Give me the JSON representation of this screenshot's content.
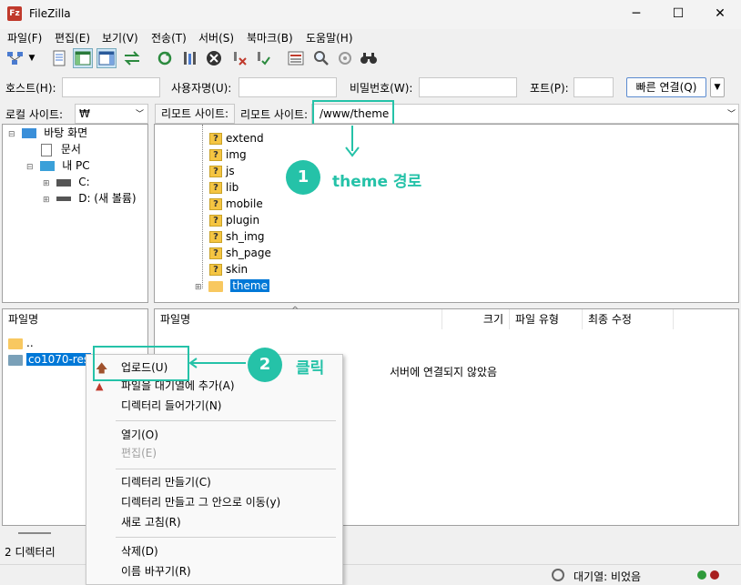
{
  "window": {
    "title": "FileZilla",
    "app_icon_glyph": "Fz",
    "minimize": "─",
    "maximize": "☐",
    "close": "✕"
  },
  "menu": [
    "파일(F)",
    "편집(E)",
    "보기(V)",
    "전송(T)",
    "서버(S)",
    "북마크(B)",
    "도움말(H)"
  ],
  "quickconnect": {
    "host_label": "호스트(H):",
    "host_value": "",
    "user_label": "사용자명(U):",
    "user_value": "",
    "pass_label": "비밀번호(W):",
    "pass_value": "",
    "port_label": "포트(P):",
    "port_value": "",
    "connect_button": "빠른 연결(Q)"
  },
  "local": {
    "site_label": "로컬 사이트:",
    "site_path": "₩",
    "tree": [
      "바탕 화면",
      "문서",
      "내 PC",
      "C:",
      "D: (새 볼륨)"
    ],
    "list_header": "파일명",
    "files": [
      "..",
      "co1070-res"
    ],
    "status": "2 디렉터리"
  },
  "remote": {
    "site_button": "리모트 사이트:",
    "site_label": "리모트 사이트:",
    "site_path": "/www/theme",
    "tree": [
      "extend",
      "img",
      "js",
      "lib",
      "mobile",
      "plugin",
      "sh_img",
      "sh_page",
      "skin",
      "theme"
    ],
    "columns": [
      "파일명",
      "크기",
      "파일 유형",
      "최종 수정"
    ],
    "empty_message": "서버에 연결되지 않았음"
  },
  "context_menu": {
    "items": [
      {
        "label": "업로드(U)",
        "enabled": true
      },
      {
        "label": "파일을 대기열에 추가(A)",
        "enabled": true
      },
      {
        "label": "디렉터리 들어가기(N)",
        "enabled": true
      },
      {
        "label": "열기(O)",
        "enabled": true
      },
      {
        "label": "편집(E)",
        "enabled": false
      },
      {
        "label": "디렉터리 만들기(C)",
        "enabled": true
      },
      {
        "label": "디렉터리 만들고 그 안으로 이동(y)",
        "enabled": true
      },
      {
        "label": "새로 고침(R)",
        "enabled": true
      },
      {
        "label": "삭제(D)",
        "enabled": true
      },
      {
        "label": "이름 바꾸기(R)",
        "enabled": true
      }
    ]
  },
  "annotations": [
    {
      "number": "1",
      "text": "theme 경로"
    },
    {
      "number": "2",
      "text": "클릭"
    }
  ],
  "statusbar": {
    "queue": "대기열: 비었음"
  },
  "colors": {
    "accent": "#25c2a8",
    "selection": "#0078d7"
  }
}
